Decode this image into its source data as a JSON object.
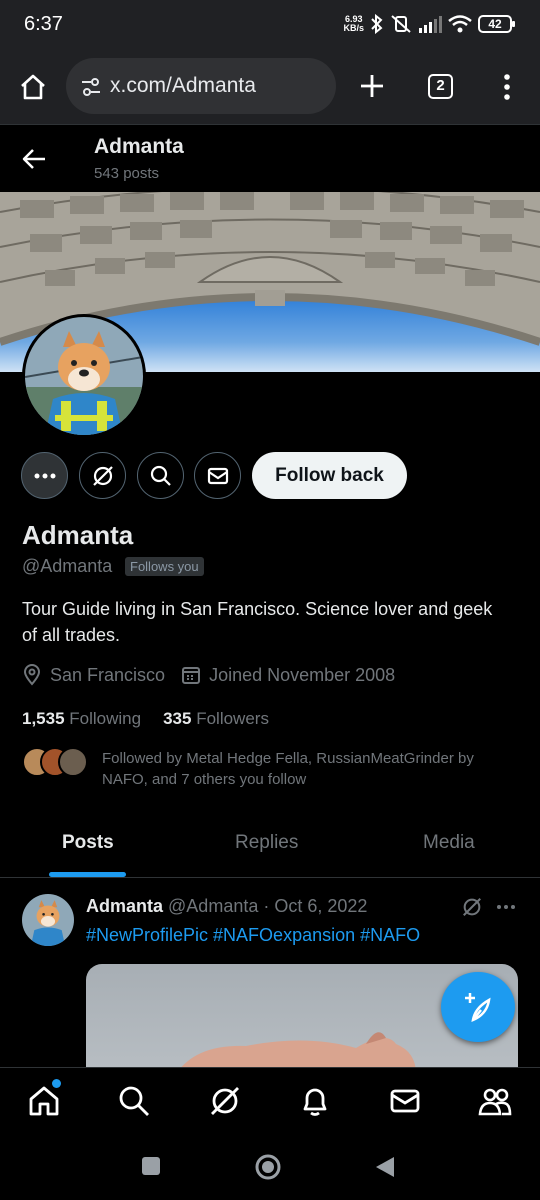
{
  "status": {
    "time": "6:37",
    "net_speed_value": "6.93",
    "net_speed_unit": "KB/s",
    "battery": "42"
  },
  "browser": {
    "url": "x.com/Admanta",
    "tab_count": "2"
  },
  "header": {
    "name": "Admanta",
    "posts": "543 posts"
  },
  "profile": {
    "name": "Admanta",
    "handle": "@Admanta",
    "follows_you": "Follows you",
    "bio": "Tour Guide living in San Francisco. Science lover and geek of all trades.",
    "location": "San Francisco",
    "joined": "Joined November 2008",
    "following_count": "1,535",
    "following_label": "Following",
    "followers_count": "335",
    "followers_label": "Followers",
    "followed_by": "Followed by Metal Hedge Fella, RussianMeatGrinder by NAFO, and 7 others you follow",
    "follow_back": "Follow back"
  },
  "tabs": [
    {
      "label": "Posts",
      "active": true
    },
    {
      "label": "Replies",
      "active": false
    },
    {
      "label": "Media",
      "active": false
    }
  ],
  "post": {
    "author": "Admanta",
    "handle": "@Admanta",
    "date": "· Oct 6, 2022",
    "hashtags": "#NewProfilePic #NAFOexpansion #NAFO"
  },
  "icons": [
    "home-icon",
    "tune-icon",
    "plus-icon",
    "tabs-icon",
    "menu-icon",
    "back-arrow-icon",
    "more-icon",
    "grok-icon",
    "search-icon",
    "mail-icon",
    "location-icon",
    "calendar-icon",
    "compose-icon",
    "notifications-icon",
    "communities-icon"
  ],
  "colors": {
    "accent": "#1d9bf0",
    "background": "#000000",
    "muted": "#71767b",
    "text": "#e7e9ea"
  }
}
